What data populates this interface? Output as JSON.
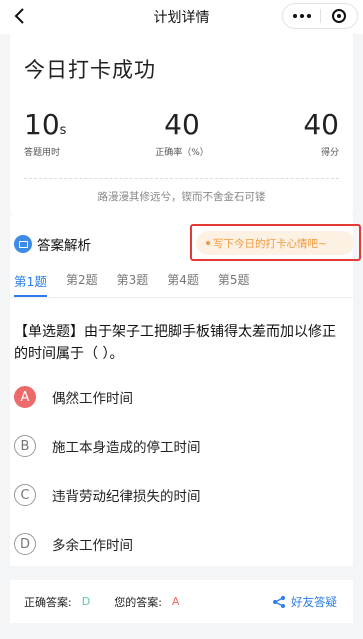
{
  "nav": {
    "title": "计划详情"
  },
  "result": {
    "title": "今日打卡成功",
    "time_value": "10",
    "time_unit": "s",
    "time_label": "答题用时",
    "accuracy_value": "40",
    "accuracy_label": "正确率（%）",
    "score_value": "40",
    "score_label": "得分",
    "motto": "路漫漫其修远兮，锲而不舍金石可镂"
  },
  "answer": {
    "section_title": "答案解析",
    "mood_button": "写下今日的打卡心情吧~",
    "tabs": [
      "第1题",
      "第2题",
      "第3题",
      "第4题",
      "第5题"
    ],
    "question": "【单选题】由于架子工把脚手板铺得太差而加以修正的时间属于（    ）。",
    "options": [
      {
        "letter": "A",
        "text": "偶然工作时间",
        "selected": true
      },
      {
        "letter": "B",
        "text": "施工本身造成的停工时间",
        "selected": false
      },
      {
        "letter": "C",
        "text": "违背劳动纪律损失的时间",
        "selected": false
      },
      {
        "letter": "D",
        "text": "多余工作时间",
        "selected": false
      }
    ]
  },
  "bottom": {
    "correct_label": "正确答案:",
    "correct_value": "D",
    "mine_label": "您的答案:",
    "mine_value": "A",
    "share_label": "好友答疑"
  },
  "colors": {
    "accent": "#2b7de9",
    "selected_option": "#ed6a6a",
    "correct": "#58c9a1",
    "mood": "#f09a3e",
    "highlight_box": "#e53935"
  }
}
